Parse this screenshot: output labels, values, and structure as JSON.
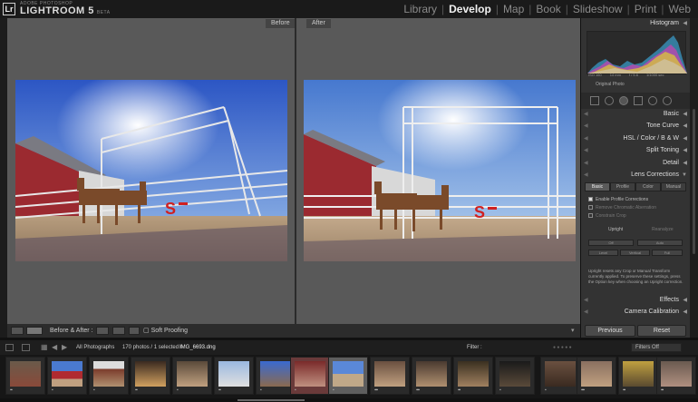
{
  "app": {
    "logo_mark": "Lr",
    "brand_sub": "ADOBE PHOTOSHOP",
    "brand": "LIGHTROOM 5",
    "brand_beta": "BETA"
  },
  "modules": [
    {
      "label": "Library",
      "active": false
    },
    {
      "label": "Develop",
      "active": true
    },
    {
      "label": "Map",
      "active": false
    },
    {
      "label": "Book",
      "active": false
    },
    {
      "label": "Slideshow",
      "active": false
    },
    {
      "label": "Print",
      "active": false
    },
    {
      "label": "Web",
      "active": false
    }
  ],
  "viewer": {
    "before_label": "Before",
    "after_label": "After"
  },
  "toolbar": {
    "before_after_label": "Before & After :",
    "soft_proofing": "Soft Proofing"
  },
  "panel": {
    "histogram": "Histogram",
    "hist_info": [
      "ISO 160",
      "14 mm",
      "f / 5.6",
      "1/1000 sec"
    ],
    "original_photo": "Original Photo",
    "sections": [
      "Basic",
      "Tone Curve",
      "HSL / Color / B & W",
      "Split Toning",
      "Detail",
      "Lens Corrections",
      "Effects",
      "Camera Calibration"
    ],
    "lens_tabs": [
      {
        "label": "Basic",
        "active": true
      },
      {
        "label": "Profile",
        "active": false
      },
      {
        "label": "Color",
        "active": false
      },
      {
        "label": "Manual",
        "active": false
      }
    ],
    "checks": [
      {
        "label": "Enable Profile Corrections",
        "on": true
      },
      {
        "label": "Remove Chromatic Aberration",
        "on": false
      },
      {
        "label": "Constrain Crop",
        "on": false
      }
    ],
    "upright_label": "Upright",
    "reanalyze": "Reanalyze",
    "upright_buttons": [
      "Off",
      "Auto",
      "Level",
      "Vertical",
      "Full"
    ],
    "help_text": "Upright resets any Crop or Manual Transform currently applied. To preserve these settings, press the Option key when choosing an Upright correction.",
    "previous": "Previous",
    "reset": "Reset"
  },
  "filmstrip_bar": {
    "source": "All Photographs",
    "count": "170 photos / 1 selected /",
    "selected_file": "IMG_6693.dng",
    "filter_label": "Filter :",
    "filter_value": "Filters Off"
  },
  "colors": {
    "accent_active": "#f0f0f0",
    "panel_bg": "#333333",
    "viewer_bg": "#595959"
  }
}
